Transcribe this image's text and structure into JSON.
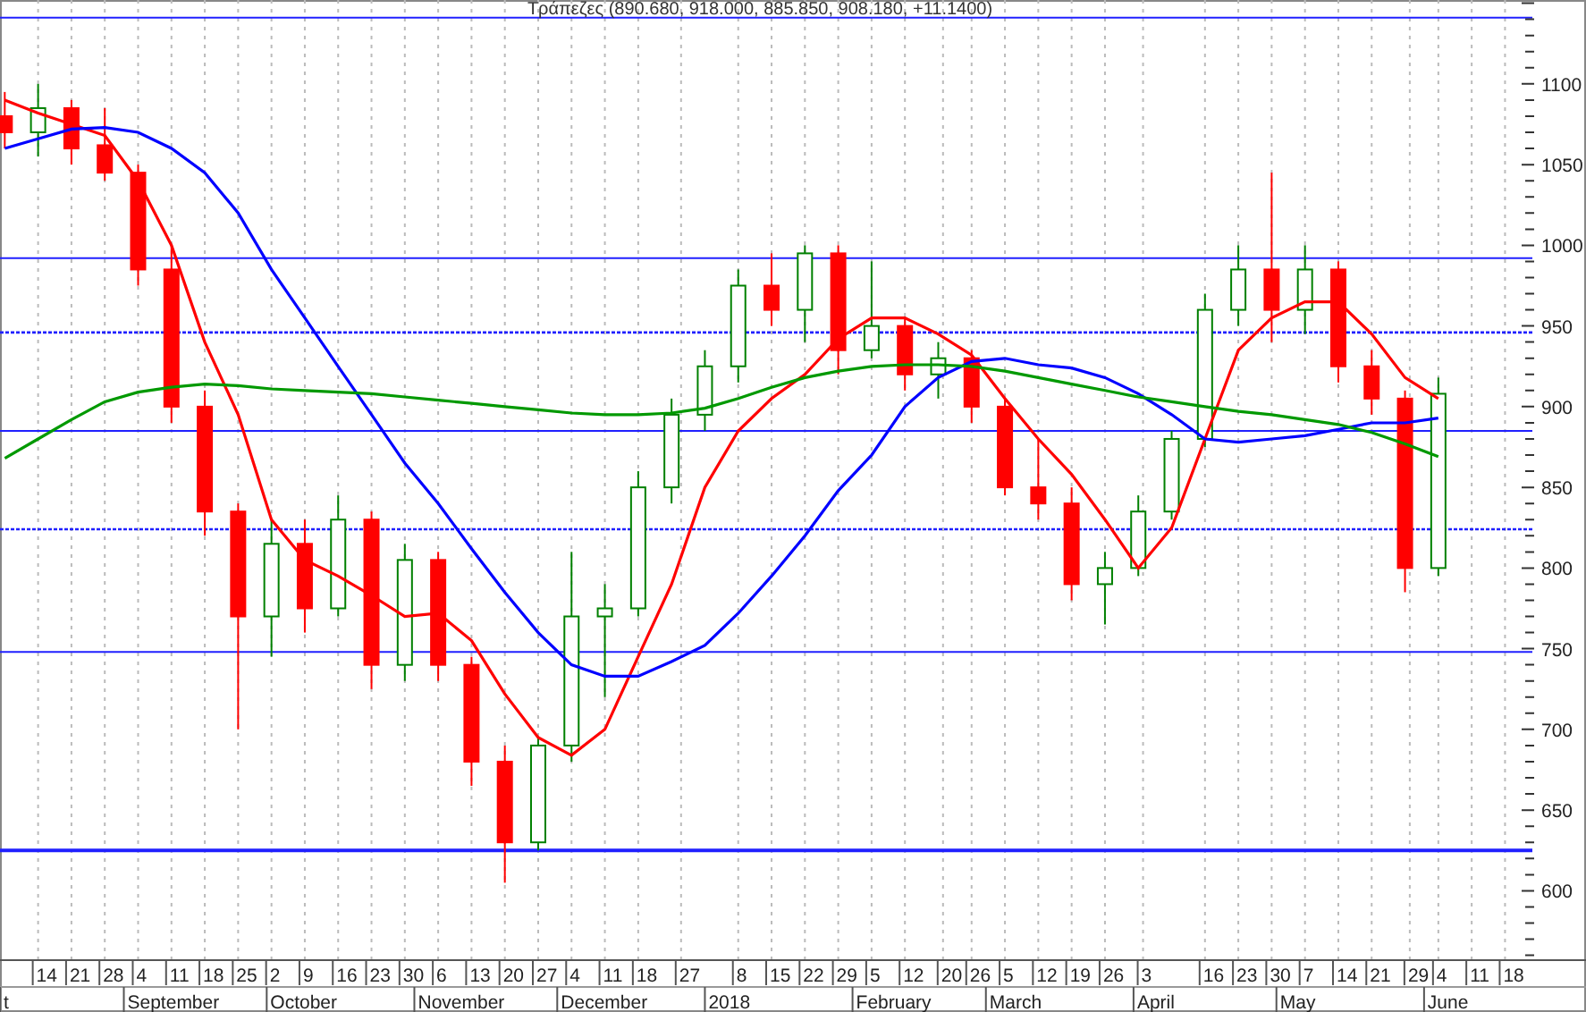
{
  "chart": {
    "chart_data": {
      "type": "candlestick",
      "title": "Τράπεζες (890.680, 918.000, 885.850, 908.180, +11.1400)",
      "x": [
        "2017-08-07",
        "2017-08-14",
        "2017-08-21",
        "2017-08-28",
        "2017-09-04",
        "2017-09-11",
        "2017-09-18",
        "2017-09-25",
        "2017-10-02",
        "2017-10-09",
        "2017-10-16",
        "2017-10-23",
        "2017-10-30",
        "2017-11-06",
        "2017-11-13",
        "2017-11-20",
        "2017-11-27",
        "2017-12-04",
        "2017-12-11",
        "2017-12-18",
        "2017-12-25",
        "2018-01-01",
        "2018-01-08",
        "2018-01-15",
        "2018-01-22",
        "2018-01-29",
        "2018-02-05",
        "2018-02-12",
        "2018-02-19",
        "2018-02-26",
        "2018-03-05",
        "2018-03-12",
        "2018-03-19",
        "2018-03-26",
        "2018-04-02",
        "2018-04-09",
        "2018-04-16",
        "2018-04-23",
        "2018-04-30",
        "2018-05-07",
        "2018-05-14",
        "2018-05-21",
        "2018-05-28",
        "2018-06-04"
      ],
      "xlim": [
        "2017-08-06",
        "2018-07-05"
      ],
      "ylim": [
        557,
        1152
      ],
      "yticks": [
        600,
        650,
        700,
        750,
        800,
        850,
        900,
        950,
        1000,
        1050,
        1100
      ],
      "xticks": [
        {
          "value": "2017-08-14",
          "label": "14"
        },
        {
          "value": "2017-08-21",
          "label": "21"
        },
        {
          "value": "2017-08-28",
          "label": "28"
        },
        {
          "value": "2017-09-04",
          "label": "4"
        },
        {
          "value": "2017-09-11",
          "label": "11"
        },
        {
          "value": "2017-09-18",
          "label": "18"
        },
        {
          "value": "2017-09-25",
          "label": "25"
        },
        {
          "value": "2017-10-02",
          "label": "2"
        },
        {
          "value": "2017-10-09",
          "label": "9"
        },
        {
          "value": "2017-10-16",
          "label": "16"
        },
        {
          "value": "2017-10-23",
          "label": "23"
        },
        {
          "value": "2017-10-30",
          "label": "30"
        },
        {
          "value": "2017-11-06",
          "label": "6"
        },
        {
          "value": "2017-11-13",
          "label": "13"
        },
        {
          "value": "2017-11-20",
          "label": "20"
        },
        {
          "value": "2017-11-27",
          "label": "27"
        },
        {
          "value": "2017-12-04",
          "label": "4"
        },
        {
          "value": "2017-12-11",
          "label": "11"
        },
        {
          "value": "2017-12-18",
          "label": "18"
        },
        {
          "value": "2017-12-27",
          "label": "27"
        },
        {
          "value": "2018-01-08",
          "label": "8"
        },
        {
          "value": "2018-01-15",
          "label": "15"
        },
        {
          "value": "2018-01-22",
          "label": "22"
        },
        {
          "value": "2018-01-29",
          "label": "29"
        },
        {
          "value": "2018-02-05",
          "label": "5"
        },
        {
          "value": "2018-02-12",
          "label": "12"
        },
        {
          "value": "2018-02-20",
          "label": "20"
        },
        {
          "value": "2018-02-26",
          "label": "26"
        },
        {
          "value": "2018-03-05",
          "label": "5"
        },
        {
          "value": "2018-03-12",
          "label": "12"
        },
        {
          "value": "2018-03-19",
          "label": "19"
        },
        {
          "value": "2018-03-26",
          "label": "26"
        },
        {
          "value": "2018-04-03",
          "label": "3"
        },
        {
          "value": "2018-04-16",
          "label": "16"
        },
        {
          "value": "2018-04-23",
          "label": "23"
        },
        {
          "value": "2018-04-30",
          "label": "30"
        },
        {
          "value": "2018-05-07",
          "label": "7"
        },
        {
          "value": "2018-05-14",
          "label": "14"
        },
        {
          "value": "2018-05-21",
          "label": "21"
        },
        {
          "value": "2018-05-29",
          "label": "29"
        },
        {
          "value": "2018-06-04",
          "label": "4"
        },
        {
          "value": "2018-06-11",
          "label": "11"
        },
        {
          "value": "2018-06-18",
          "label": "18"
        }
      ],
      "ohlc": [
        [
          1080,
          1095,
          1060,
          1070
        ],
        [
          1070,
          1100,
          1055,
          1085
        ],
        [
          1085,
          1090,
          1050,
          1060
        ],
        [
          1062,
          1085,
          1040,
          1045
        ],
        [
          1045,
          1050,
          975,
          985
        ],
        [
          985,
          1000,
          890,
          900
        ],
        [
          900,
          910,
          820,
          835
        ],
        [
          835,
          840,
          700,
          770
        ],
        [
          770,
          830,
          745,
          815
        ],
        [
          815,
          830,
          760,
          775
        ],
        [
          775,
          845,
          770,
          830
        ],
        [
          830,
          835,
          725,
          740
        ],
        [
          740,
          815,
          730,
          805
        ],
        [
          805,
          810,
          730,
          740
        ],
        [
          740,
          745,
          665,
          680
        ],
        [
          680,
          690,
          605,
          630
        ],
        [
          630,
          695,
          625,
          690
        ],
        [
          690,
          810,
          680,
          770
        ],
        [
          770,
          790,
          720,
          775
        ],
        [
          775,
          860,
          770,
          850
        ],
        [
          850,
          905,
          840,
          895
        ],
        [
          895,
          935,
          885,
          925
        ],
        [
          925,
          985,
          915,
          975
        ],
        [
          975,
          995,
          950,
          960
        ],
        [
          960,
          1000,
          940,
          995
        ],
        [
          995,
          1000,
          920,
          935
        ],
        [
          935,
          990,
          930,
          950
        ],
        [
          950,
          955,
          910,
          920
        ],
        [
          920,
          940,
          905,
          930
        ],
        [
          930,
          935,
          890,
          900
        ],
        [
          900,
          905,
          845,
          850
        ],
        [
          850,
          880,
          830,
          840
        ],
        [
          840,
          850,
          780,
          790
        ],
        [
          790,
          810,
          765,
          800
        ],
        [
          800,
          845,
          795,
          835
        ],
        [
          835,
          885,
          830,
          880
        ],
        [
          880,
          970,
          875,
          960
        ],
        [
          960,
          1000,
          950,
          985
        ],
        [
          985,
          1045,
          940,
          960
        ],
        [
          960,
          1000,
          945,
          985
        ],
        [
          985,
          990,
          915,
          925
        ],
        [
          925,
          935,
          895,
          905
        ],
        [
          905,
          910,
          785,
          800
        ],
        [
          800,
          918,
          795,
          908
        ]
      ],
      "series": [
        {
          "type": "line",
          "color": "#ff0000",
          "values": [
            1090,
            1082,
            1075,
            1068,
            1040,
            1000,
            940,
            895,
            830,
            805,
            795,
            783,
            770,
            772,
            755,
            722,
            695,
            684,
            700,
            745,
            790,
            850,
            885,
            905,
            920,
            942,
            955,
            955,
            945,
            932,
            905,
            880,
            858,
            830,
            800,
            825,
            880,
            935,
            955,
            965,
            965,
            945,
            918,
            905
          ]
        },
        {
          "type": "line",
          "color": "#0000ff",
          "values": [
            1060,
            1066,
            1072,
            1073,
            1070,
            1060,
            1045,
            1020,
            985,
            955,
            925,
            895,
            865,
            840,
            812,
            785,
            760,
            740,
            733,
            733,
            742,
            752,
            772,
            795,
            820,
            848,
            870,
            900,
            918,
            928,
            930,
            926,
            924,
            918,
            908,
            895,
            880,
            878,
            880,
            882,
            886,
            890,
            890,
            893
          ]
        },
        {
          "type": "line",
          "color": "#009900",
          "values": [
            868,
            880,
            892,
            903,
            909,
            912,
            914,
            913,
            911,
            910,
            909,
            908,
            906,
            904,
            902,
            900,
            898,
            896,
            895,
            895,
            896,
            899,
            905,
            912,
            918,
            922,
            925,
            926,
            926,
            925,
            922,
            918,
            914,
            910,
            906,
            903,
            900,
            897,
            895,
            892,
            889,
            884,
            877,
            869
          ]
        }
      ],
      "grid": true,
      "ref_lines": [
        {
          "axis": "y",
          "value": 1141
        },
        {
          "axis": "y",
          "value": 992
        },
        {
          "axis": "y",
          "value": 946
        },
        {
          "axis": "y",
          "value": 885
        },
        {
          "axis": "y",
          "value": 824
        },
        {
          "axis": "y",
          "value": 748
        },
        {
          "axis": "y",
          "value": 625
        }
      ]
    },
    "month_labels": [
      "t",
      "September",
      "October",
      "November",
      "December",
      "2018",
      "February",
      "March",
      "April",
      "May",
      "June"
    ]
  }
}
